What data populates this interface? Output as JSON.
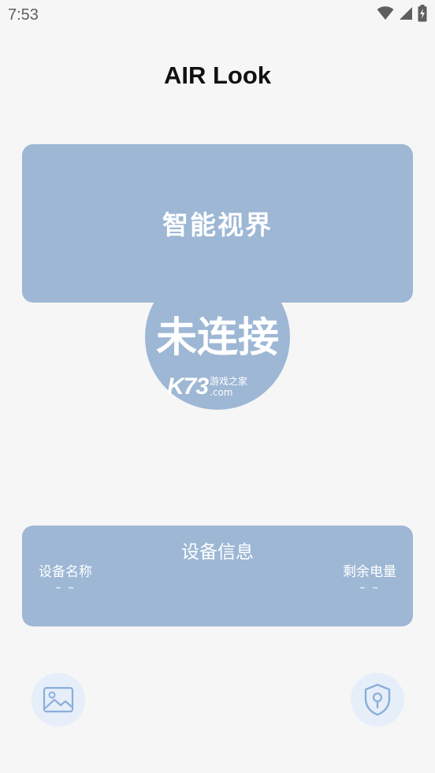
{
  "status_bar": {
    "time": "7:53",
    "icons": [
      "wifi-icon",
      "cellular-signal-icon",
      "battery-charging-icon"
    ]
  },
  "header": {
    "title": "AIR Look"
  },
  "vision_card": {
    "title": "智能视界"
  },
  "connection": {
    "status_text": "未连接"
  },
  "watermark": {
    "main": "K73",
    "cn": "游戏之家",
    "domain": ".com"
  },
  "device_info": {
    "title": "设备信息",
    "name_label": "设备名称",
    "name_value": "– –",
    "battery_label": "剩余电量",
    "battery_value": "– –"
  },
  "bottom_actions": {
    "gallery_icon": "image-gallery-icon",
    "security_icon": "shield-key-icon"
  },
  "colors": {
    "background": "#f6f6f6",
    "card": "#9db7d5",
    "fab_background": "#e6eef9",
    "fab_icon": "#8aaedb"
  }
}
